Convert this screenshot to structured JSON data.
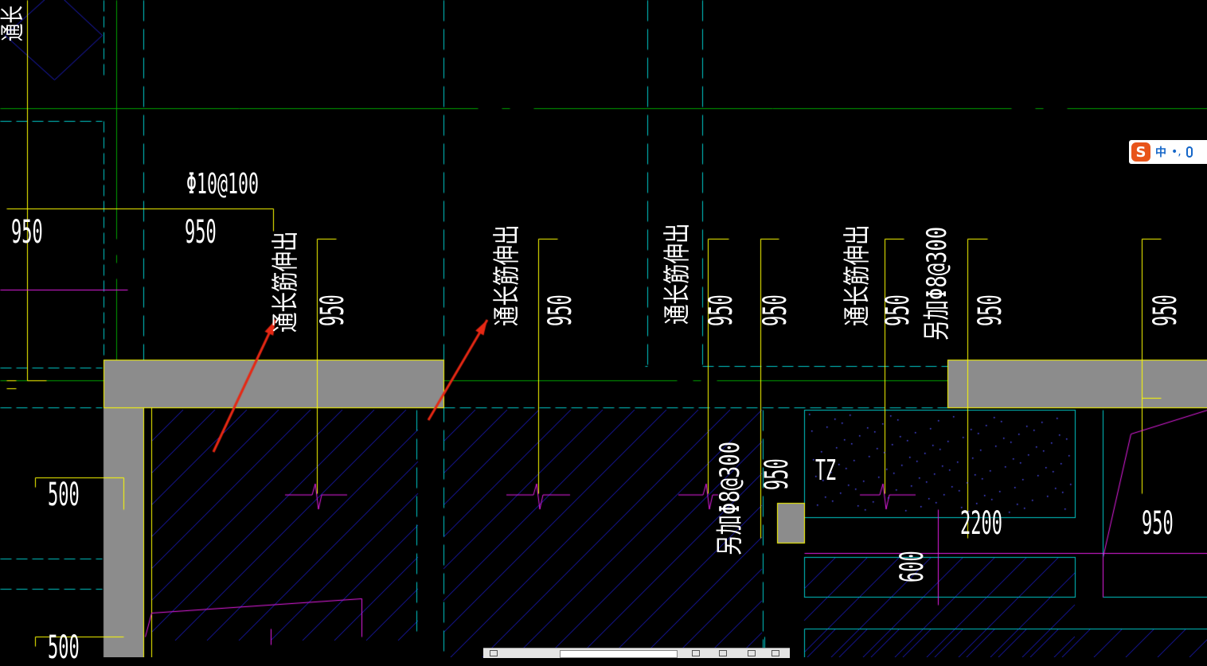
{
  "drawing": {
    "rebar_spec_top": "Φ10@100",
    "dims": {
      "d950_left": "950",
      "d950_left2": "950",
      "d500_upper": "500",
      "d500_lower": "500",
      "d2200": "2200",
      "d950_right": "950",
      "d600": "600"
    },
    "vertical_dims": {
      "v950_a": "950",
      "v950_b": "950",
      "v950_c": "950",
      "v950_d": "950",
      "v950_e": "950",
      "v950_f": "950",
      "v950_g": "950",
      "v950_h": "950"
    },
    "notes": {
      "through_rebar_1": "通长筋伸出",
      "through_rebar_2": "通长筋伸出",
      "through_rebar_3": "通长筋伸出",
      "through_rebar_4": "通长筋伸出",
      "extra_rebar_top": "另加Φ8@300",
      "extra_rebar_mid": "另加Φ8@300"
    },
    "column_tag": "TZ",
    "edge_fragment": "通长"
  },
  "ime_toolbar": {
    "logo_icon": "sogou-s-icon",
    "logo_letter": "S",
    "language": "中",
    "punctuation": "•,",
    "mic_icon": "microphone-icon"
  },
  "colors": {
    "background": "#000000",
    "yellow_line": "#ffff00",
    "cyan_dash": "#00c8c8",
    "green_line": "#00a000",
    "blue_hatch": "#1e1ec8",
    "magenta": "#e61ee6",
    "wall_fill": "#8c8c8c",
    "arrow_red": "#e62814"
  }
}
